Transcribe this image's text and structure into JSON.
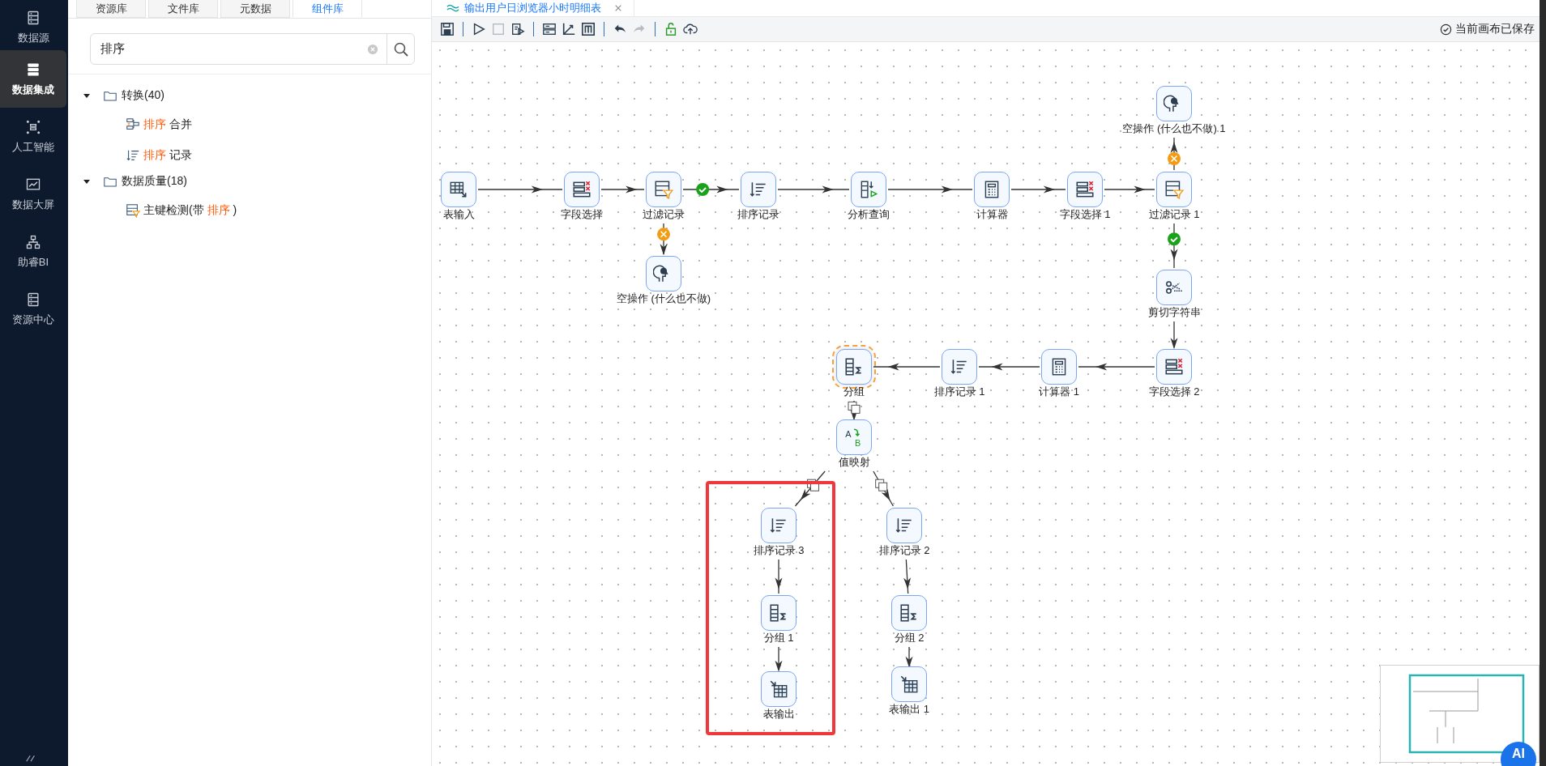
{
  "nav": {
    "items": [
      {
        "kind": "datasource",
        "label": "数据源",
        "selected": false
      },
      {
        "kind": "integration",
        "label": "数据集成",
        "selected": true
      },
      {
        "kind": "ai",
        "label": "人工智能",
        "selected": false
      },
      {
        "kind": "screen",
        "label": "数据大屏",
        "selected": false
      },
      {
        "kind": "bi",
        "label": "助睿BI",
        "selected": false
      },
      {
        "kind": "resource",
        "label": "资源中心",
        "selected": false
      }
    ]
  },
  "panel": {
    "tabs": [
      {
        "label": "资源库",
        "selected": false
      },
      {
        "label": "文件库",
        "selected": false
      },
      {
        "label": "元数据",
        "selected": false
      },
      {
        "label": "组件库",
        "selected": true
      }
    ],
    "search": {
      "value": "排序"
    },
    "tree": [
      {
        "label": "转换(40)",
        "expanded": true,
        "children": [
          {
            "kind": "merge",
            "parts": [
              {
                "text": "排序",
                "highlight": true
              },
              {
                "text": " 合并",
                "highlight": false
              }
            ]
          },
          {
            "kind": "sort",
            "parts": [
              {
                "text": "排序",
                "highlight": true
              },
              {
                "text": " 记录",
                "highlight": false
              }
            ]
          }
        ]
      },
      {
        "label": "数据质量(18)",
        "expanded": true,
        "children": [
          {
            "kind": "check",
            "parts": [
              {
                "text": "主键检测(带 ",
                "highlight": false
              },
              {
                "text": "排序",
                "highlight": true
              },
              {
                "text": " )",
                "highlight": false
              }
            ]
          }
        ]
      }
    ]
  },
  "editor": {
    "tab": {
      "title": "输出用户日浏览器小时明细表"
    },
    "toolbar": [
      [
        {
          "kind": "save",
          "disabled": false
        }
      ],
      [
        {
          "kind": "run",
          "disabled": false
        },
        {
          "kind": "stop",
          "disabled": true
        },
        {
          "kind": "debug",
          "disabled": false
        }
      ],
      [
        {
          "kind": "layout",
          "disabled": false
        },
        {
          "kind": "axis",
          "disabled": false
        },
        {
          "kind": "mbox",
          "disabled": false
        }
      ],
      [
        {
          "kind": "undo",
          "disabled": false
        },
        {
          "kind": "redo",
          "disabled": true
        }
      ],
      [
        {
          "kind": "lock",
          "disabled": false
        },
        {
          "kind": "upload",
          "disabled": false
        }
      ]
    ],
    "status": "当前画布已保存",
    "nodes": [
      {
        "kind": "dummy",
        "label": "空操作 (什么也不做) 1",
        "selected": false
      },
      {
        "kind": "table-input",
        "label": "表输入",
        "selected": false
      },
      {
        "kind": "field-select",
        "label": "字段选择",
        "selected": false
      },
      {
        "kind": "filter",
        "label": "过滤记录",
        "selected": false
      },
      {
        "kind": "sort",
        "label": "排序记录",
        "selected": false
      },
      {
        "kind": "analytic",
        "label": "分析查询",
        "selected": false
      },
      {
        "kind": "calculator",
        "label": "计算器",
        "selected": false
      },
      {
        "kind": "field-select",
        "label": "字段选择 1",
        "selected": false
      },
      {
        "kind": "filter",
        "label": "过滤记录 1",
        "selected": false
      },
      {
        "kind": "dummy",
        "label": "空操作 (什么也不做)",
        "selected": false
      },
      {
        "kind": "cut-string",
        "label": "剪切字符串",
        "selected": false
      },
      {
        "kind": "group",
        "label": "分组",
        "selected": true
      },
      {
        "kind": "sort",
        "label": "排序记录 1",
        "selected": false
      },
      {
        "kind": "calculator",
        "label": "计算器 1",
        "selected": false
      },
      {
        "kind": "field-select",
        "label": "字段选择 2",
        "selected": false
      },
      {
        "kind": "value-map",
        "label": "值映射",
        "selected": false,
        "icon_letters": [
          "A",
          "B"
        ]
      },
      {
        "kind": "sort",
        "label": "排序记录 3",
        "selected": false
      },
      {
        "kind": "sort",
        "label": "排序记录 2",
        "selected": false
      },
      {
        "kind": "group",
        "label": "分组 1",
        "selected": false
      },
      {
        "kind": "group",
        "label": "分组 2",
        "selected": false
      },
      {
        "kind": "table-output",
        "label": "表输出",
        "selected": false
      },
      {
        "kind": "table-output",
        "label": "表输出 1",
        "selected": false
      }
    ],
    "edges": [
      {
        "kind": "plain"
      },
      {
        "kind": "plain"
      },
      {
        "kind": "success"
      },
      {
        "kind": "plain"
      },
      {
        "kind": "plain"
      },
      {
        "kind": "plain"
      },
      {
        "kind": "plain"
      },
      {
        "kind": "fail"
      },
      {
        "kind": "fail"
      },
      {
        "kind": "success"
      },
      {
        "kind": "plain"
      },
      {
        "kind": "plain"
      },
      {
        "kind": "plain"
      },
      {
        "kind": "plain"
      },
      {
        "kind": "copy"
      },
      {
        "kind": "copy"
      },
      {
        "kind": "copy"
      },
      {
        "kind": "plain"
      },
      {
        "kind": "plain"
      },
      {
        "kind": "plain"
      },
      {
        "kind": "plain"
      }
    ],
    "ai_button": {
      "label": "AI"
    }
  }
}
